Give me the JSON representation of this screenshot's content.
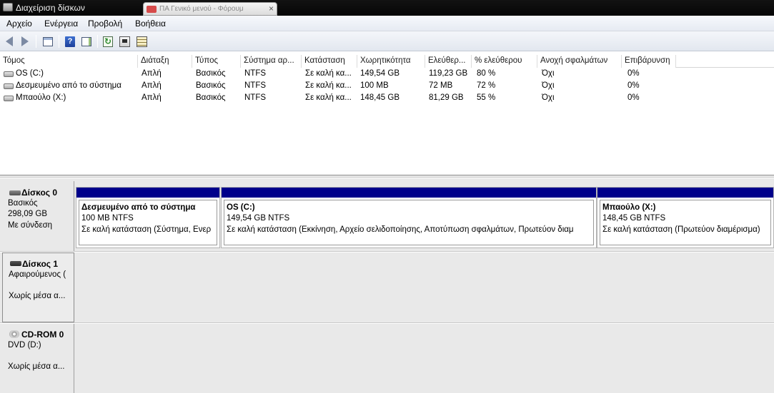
{
  "window": {
    "title": "Διαχείριση δίσκων",
    "other_tab_text": "ΠΑ Γενικό μενού - Φόρουμ"
  },
  "menu": [
    "Αρχείο",
    "Ενέργεια",
    "Προβολή",
    "Βοήθεια"
  ],
  "toolbar": {
    "icons": [
      "back-icon",
      "forward-icon",
      "console-tree-icon",
      "help-icon",
      "action-pane-icon",
      "refresh-icon",
      "check-icon",
      "properties-icon"
    ]
  },
  "volume_list": {
    "columns": [
      "Τόμος",
      "Διάταξη",
      "Τύπος",
      "Σύστημα αρ...",
      "Κατάσταση",
      "Χωρητικότητα",
      "Ελεύθερ...",
      "% ελεύθερου",
      "Ανοχή σφαλμάτων",
      "Επιβάρυνση"
    ],
    "rows": [
      [
        "OS (C:)",
        "Απλή",
        "Βασικός",
        "NTFS",
        "Σε καλή κα...",
        "149,54 GB",
        "119,23 GB",
        "80 %",
        "Όχι",
        "0%"
      ],
      [
        "Δεσμευμένο από το σύστημα",
        "Απλή",
        "Βασικός",
        "NTFS",
        "Σε καλή κα...",
        "100 MB",
        "72 MB",
        "72 %",
        "Όχι",
        "0%"
      ],
      [
        "Μπαούλο (X:)",
        "Απλή",
        "Βασικός",
        "NTFS",
        "Σε καλή κα...",
        "148,45 GB",
        "81,29 GB",
        "55 %",
        "Όχι",
        "0%"
      ]
    ]
  },
  "disks": {
    "disk0": {
      "name": "Δίσκος 0",
      "type": "Βασικός",
      "size": "298,09 GB",
      "status": "Με σύνδεση",
      "partitions": [
        {
          "title": "Δεσμευμένο από το σύστημα",
          "size": "100 MB NTFS",
          "status": "Σε καλή κατάσταση (Σύστημα, Ενερ"
        },
        {
          "title": "OS  (C:)",
          "size": "149,54 GB NTFS",
          "status": "Σε καλή κατάσταση (Εκκίνηση, Αρχείο σελιδοποίησης, Αποτύπωση σφαλμάτων, Πρωτεύον διαμ"
        },
        {
          "title": "Μπαούλο  (X:)",
          "size": "148,45 GB NTFS",
          "status": "Σε καλή κατάσταση (Πρωτεύον διαμέρισμα)"
        }
      ]
    },
    "disk1": {
      "name": "Δίσκος 1",
      "type": "Αφαιρούμενος (",
      "status": "Χωρίς μέσα α..."
    },
    "cdrom0": {
      "name": "CD-ROM 0",
      "type": "DVD (D:)",
      "status": "Χωρίς μέσα α..."
    }
  },
  "colors": {
    "partition_bar": "#00008b",
    "titlebar": "#0a0a0a"
  }
}
